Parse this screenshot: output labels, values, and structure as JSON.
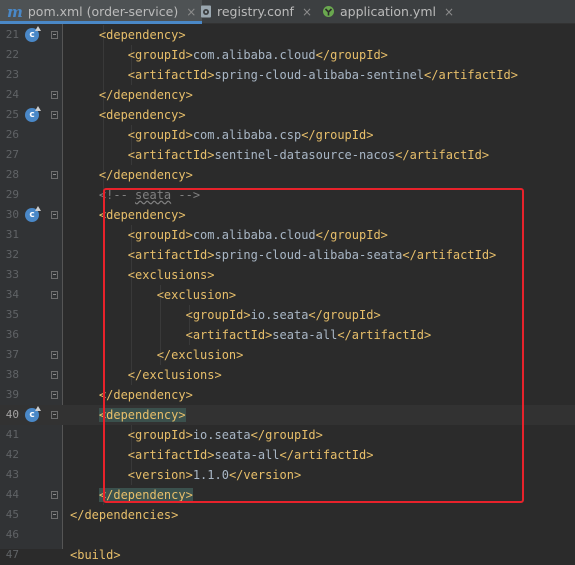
{
  "tabs": [
    {
      "label": "pom.xml (order-service)",
      "icon": "maven-icon",
      "active": true
    },
    {
      "label": "registry.conf",
      "icon": "config-file-icon",
      "active": false
    },
    {
      "label": "application.yml",
      "icon": "yaml-file-icon",
      "active": false
    }
  ],
  "close_glyph": "×",
  "maven_glyph": "m",
  "editor": {
    "current_line": 40,
    "lines": [
      {
        "num": "21",
        "indent": 2,
        "parts": [
          [
            "tag",
            "<dependency>"
          ]
        ],
        "gutter_icon": true,
        "fold": "open"
      },
      {
        "num": "22",
        "indent": 3,
        "parts": [
          [
            "tag",
            "<groupId>"
          ],
          [
            "txt",
            "com.alibaba.cloud"
          ],
          [
            "tag",
            "</groupId>"
          ]
        ]
      },
      {
        "num": "23",
        "indent": 3,
        "parts": [
          [
            "tag",
            "<artifactId>"
          ],
          [
            "txt",
            "spring-cloud-alibaba-sentinel"
          ],
          [
            "tag",
            "</artifactId>"
          ]
        ]
      },
      {
        "num": "24",
        "indent": 2,
        "parts": [
          [
            "tag",
            "</dependency>"
          ]
        ],
        "fold": "close"
      },
      {
        "num": "25",
        "indent": 2,
        "parts": [
          [
            "tag",
            "<dependency>"
          ]
        ],
        "gutter_icon": true,
        "fold": "open"
      },
      {
        "num": "26",
        "indent": 3,
        "parts": [
          [
            "tag",
            "<groupId>"
          ],
          [
            "txt",
            "com.alibaba.csp"
          ],
          [
            "tag",
            "</groupId>"
          ]
        ]
      },
      {
        "num": "27",
        "indent": 3,
        "parts": [
          [
            "tag",
            "<artifactId>"
          ],
          [
            "txt",
            "sentinel-datasource-nacos"
          ],
          [
            "tag",
            "</artifactId>"
          ]
        ]
      },
      {
        "num": "28",
        "indent": 2,
        "parts": [
          [
            "tag",
            "</dependency>"
          ]
        ],
        "fold": "close"
      },
      {
        "num": "29",
        "indent": 2,
        "parts": [
          [
            "cmt",
            "<!-- "
          ],
          [
            "cmtu",
            "seata"
          ],
          [
            "cmt",
            " -->"
          ]
        ]
      },
      {
        "num": "30",
        "indent": 2,
        "parts": [
          [
            "tag",
            "<dependency>"
          ]
        ],
        "gutter_icon": true,
        "fold": "open"
      },
      {
        "num": "31",
        "indent": 3,
        "parts": [
          [
            "tag",
            "<groupId>"
          ],
          [
            "txt",
            "com.alibaba.cloud"
          ],
          [
            "tag",
            "</groupId>"
          ]
        ]
      },
      {
        "num": "32",
        "indent": 3,
        "parts": [
          [
            "tag",
            "<artifactId>"
          ],
          [
            "txt",
            "spring-cloud-alibaba-seata"
          ],
          [
            "tag",
            "</artifactId>"
          ]
        ]
      },
      {
        "num": "33",
        "indent": 3,
        "parts": [
          [
            "tag",
            "<exclusions>"
          ]
        ],
        "fold": "open"
      },
      {
        "num": "34",
        "indent": 4,
        "parts": [
          [
            "tag",
            "<exclusion>"
          ]
        ],
        "fold": "open"
      },
      {
        "num": "35",
        "indent": 5,
        "parts": [
          [
            "tag",
            "<groupId>"
          ],
          [
            "txt",
            "io.seata"
          ],
          [
            "tag",
            "</groupId>"
          ]
        ]
      },
      {
        "num": "36",
        "indent": 5,
        "parts": [
          [
            "tag",
            "<artifactId>"
          ],
          [
            "txt",
            "seata-all"
          ],
          [
            "tag",
            "</artifactId>"
          ]
        ]
      },
      {
        "num": "37",
        "indent": 4,
        "parts": [
          [
            "tag",
            "</exclusion>"
          ]
        ],
        "fold": "close"
      },
      {
        "num": "38",
        "indent": 3,
        "parts": [
          [
            "tag",
            "</exclusions>"
          ]
        ],
        "fold": "close"
      },
      {
        "num": "39",
        "indent": 2,
        "parts": [
          [
            "tag",
            "</dependency>"
          ]
        ],
        "fold": "close"
      },
      {
        "num": "40",
        "indent": 2,
        "parts": [
          [
            "taghl",
            "<dependency>"
          ]
        ],
        "gutter_icon": true,
        "fold": "open"
      },
      {
        "num": "41",
        "indent": 3,
        "parts": [
          [
            "tag",
            "<groupId>"
          ],
          [
            "txt",
            "io.seata"
          ],
          [
            "tag",
            "</groupId>"
          ]
        ]
      },
      {
        "num": "42",
        "indent": 3,
        "parts": [
          [
            "tag",
            "<artifactId>"
          ],
          [
            "txt",
            "seata-all"
          ],
          [
            "tag",
            "</artifactId>"
          ]
        ]
      },
      {
        "num": "43",
        "indent": 3,
        "parts": [
          [
            "tag",
            "<version>"
          ],
          [
            "txt",
            "1.1.0"
          ],
          [
            "tag",
            "</version>"
          ]
        ]
      },
      {
        "num": "44",
        "indent": 2,
        "parts": [
          [
            "taghl",
            "</dependency>"
          ]
        ],
        "fold": "close"
      },
      {
        "num": "45",
        "indent": 1,
        "parts": [
          [
            "tag",
            "</dependencies>"
          ]
        ],
        "fold": "close"
      },
      {
        "num": "46",
        "indent": 0,
        "parts": []
      },
      {
        "num": "47",
        "indent": 1,
        "parts": [
          [
            "tag",
            "<build>"
          ]
        ]
      }
    ]
  },
  "colors": {
    "background": "#2b2b2b",
    "gutter": "#313335",
    "tag": "#e8bf6a",
    "text": "#a9b7c6",
    "comment": "#808080",
    "annotation_border": "#e8222b",
    "tab_accent": "#4a88c7"
  }
}
